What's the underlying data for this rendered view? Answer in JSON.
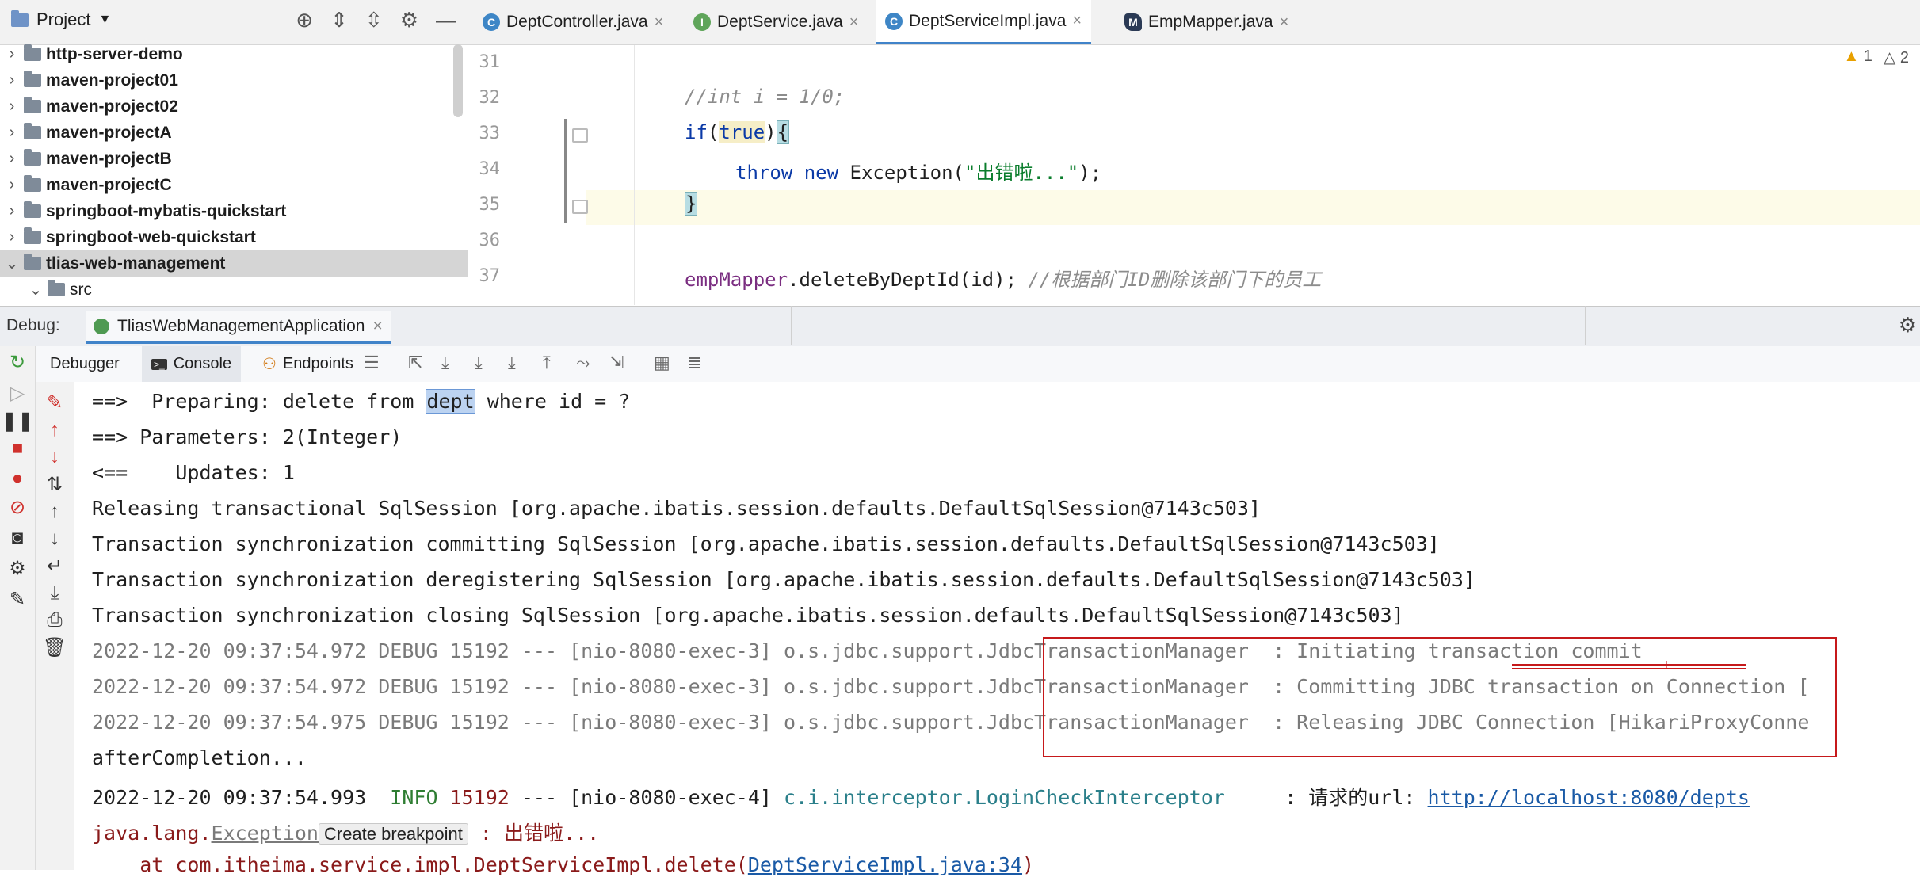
{
  "project": {
    "title": "Project",
    "items": [
      {
        "label": "http-server-demo",
        "expanded": false
      },
      {
        "label": "maven-project01",
        "expanded": false
      },
      {
        "label": "maven-project02",
        "expanded": false
      },
      {
        "label": "maven-projectA",
        "expanded": false
      },
      {
        "label": "maven-projectB",
        "expanded": false
      },
      {
        "label": "maven-projectC",
        "expanded": false
      },
      {
        "label": "springboot-mybatis-quickstart",
        "expanded": false
      },
      {
        "label": "springboot-web-quickstart",
        "expanded": false
      },
      {
        "label": "tlias-web-management",
        "expanded": true,
        "selected": true
      },
      {
        "label": "src",
        "expanded": true
      }
    ]
  },
  "editor": {
    "tabs": [
      {
        "label": "DeptController.java",
        "icon": "C",
        "close": "×"
      },
      {
        "label": "DeptService.java",
        "icon": "I",
        "close": "×"
      },
      {
        "label": "DeptServiceImpl.java",
        "icon": "C",
        "close": "×",
        "active": true
      },
      {
        "label": "EmpMapper.java",
        "icon": "M",
        "close": "×"
      }
    ],
    "warnings": {
      "errors": "1",
      "warnings": "2"
    },
    "line_numbers": [
      "31",
      "32",
      "33",
      "34",
      "35",
      "36",
      "37"
    ],
    "code": {
      "l32": "//int i = 1/0;",
      "l33_kw": "if",
      "l33_p1": "(",
      "l33_true": "true",
      "l33_p2": ")",
      "l33_brace": "{",
      "l34_throw": "throw",
      "l34_new": "new",
      "l34_cls": "Exception(",
      "l34_str": "\"出错啦...\"",
      "l34_end": ");",
      "l35_brace": "}",
      "l37_field": "empMapper",
      "l37_call": ".deleteByDeptId(id); ",
      "l37_comment": "//根据部门ID删除该部门下的员工"
    }
  },
  "debug": {
    "label": "Debug:",
    "session": "TliasWebManagementApplication",
    "session_close": "×",
    "tabs": [
      "Debugger",
      "Console",
      "Endpoints"
    ]
  },
  "console": {
    "l1_a": "==>  Preparing: delete from ",
    "l1_sel": "dept",
    "l1_b": " where id = ?",
    "l2": "==> Parameters: 2(Integer)",
    "l3": "<==    Updates: 1",
    "l4": "Releasing transactional SqlSession [org.apache.ibatis.session.defaults.DefaultSqlSession@7143c503]",
    "l5": "Transaction synchronization committing SqlSession [org.apache.ibatis.session.defaults.DefaultSqlSession@7143c503]",
    "l6": "Transaction synchronization deregistering SqlSession [org.apache.ibatis.session.defaults.DefaultSqlSession@7143c503]",
    "l7": "Transaction synchronization closing SqlSession [org.apache.ibatis.session.defaults.DefaultSqlSession@7143c503]",
    "l8": "2022-12-20 09:37:54.972 DEBUG 15192 --- [nio-8080-exec-3] o.s.jdbc.support.JdbcTransactionManager  : Initiating transaction commit",
    "l9": "2022-12-20 09:37:54.972 DEBUG 15192 --- [nio-8080-exec-3] o.s.jdbc.support.JdbcTransactionManager  : Committing JDBC transaction on Connection [",
    "l10": "2022-12-20 09:37:54.975 DEBUG 15192 --- [nio-8080-exec-3] o.s.jdbc.support.JdbcTransactionManager  : Releasing JDBC Connection [HikariProxyConne",
    "l11": "afterCompletion...",
    "l12_a": "2022-12-20 09:37:54.993  ",
    "l12_info": "INFO",
    "l12_pid": " 15192",
    "l12_b": " --- [nio-8080-exec-4] ",
    "l12_logger": "c.i.interceptor.LoginCheckInterceptor",
    "l12_c": "     : 请求的url: ",
    "l12_url": "http://localhost:8080/depts",
    "l13_a": "java.lang.",
    "l13_exc": "Exception",
    "l13_chip": "Create breakpoint",
    "l13_b": " : 出错啦...",
    "l14_a": "    at com.itheima.service.impl.DeptServiceImpl.delete(",
    "l14_link": "DeptServiceImpl.java:34",
    "l14_b": ")"
  },
  "colors": {
    "accent": "#4083c9",
    "highlight_box": "#c6191b",
    "current_line": "#fdfbe8"
  }
}
